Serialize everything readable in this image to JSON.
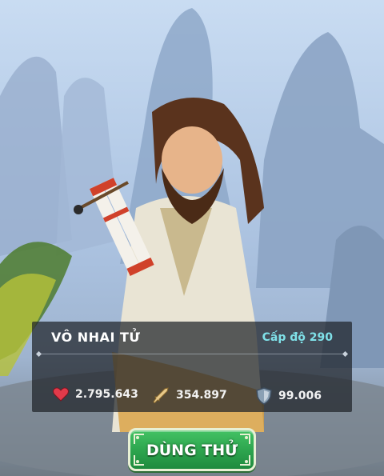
{
  "character": {
    "name": "VÔ NHAI TỬ",
    "level": "Cấp độ 290"
  },
  "stats": {
    "hp": "2.795.643",
    "attack": "354.897",
    "defense": "99.006"
  },
  "actions": {
    "try_button_label": "DÙNG THỬ"
  },
  "icons": {
    "hp": "heart-icon",
    "attack": "sword-icon",
    "defense": "shield-icon"
  },
  "colors": {
    "level_text": "#7fe0e8",
    "button_green": "#2ea64f",
    "panel_bg": "rgba(30,34,40,0.72)"
  }
}
